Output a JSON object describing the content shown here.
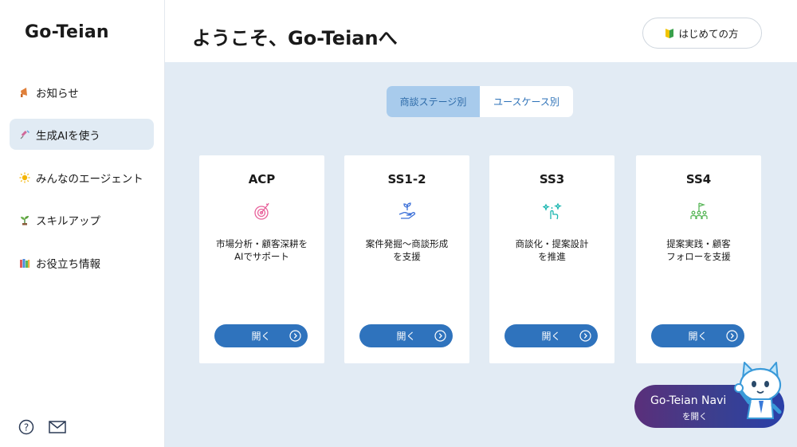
{
  "sidebar": {
    "brand": "Go-Teian",
    "items": [
      {
        "label": "お知らせ",
        "icon": "megaphone-icon",
        "active": false
      },
      {
        "label": "生成AIを使う",
        "icon": "syringe-icon",
        "active": true
      },
      {
        "label": "みんなのエージェント",
        "icon": "sun-icon",
        "active": false
      },
      {
        "label": "スキルアップ",
        "icon": "sprout-icon",
        "active": false
      },
      {
        "label": "お役立ち情報",
        "icon": "books-icon",
        "active": false
      }
    ],
    "footer_icons": [
      "help-circle-icon",
      "mail-icon"
    ]
  },
  "header": {
    "title": "ようこそ、Go-Teianへ",
    "beginner_button": "はじめての方",
    "beginner_icon": "beginner-mark-icon"
  },
  "main": {
    "tabs": [
      {
        "label": "商談ステージ別",
        "active": true
      },
      {
        "label": "ユースケース別",
        "active": false
      }
    ],
    "cards": [
      {
        "title": "ACP",
        "icon": "target-icon",
        "icon_color": "#e8609a",
        "description": "市場分析・顧客深耕を\nAIでサポート",
        "button": "開く"
      },
      {
        "title": "SS1-2",
        "icon": "hand-plant-icon",
        "icon_color": "#3a6fd8",
        "description": "案件発掘〜商談形成\nを支援",
        "button": "開く"
      },
      {
        "title": "SS3",
        "icon": "sparkle-hand-icon",
        "icon_color": "#1bb6b0",
        "description": "商談化・提案設計\nを推進",
        "button": "開く"
      },
      {
        "title": "SS4",
        "icon": "team-flag-icon",
        "icon_color": "#5cb85c",
        "description": "提案実践・顧客\nフォローを支援",
        "button": "開く"
      }
    ]
  },
  "navi": {
    "title": "Go-Teian Navi",
    "subtitle": "を開く",
    "mascot": "cat-mascot-icon"
  },
  "colors": {
    "accent": "#2f73bd",
    "main_bg": "#e2ebf4",
    "active_tab": "#a8cbec",
    "sidebar_active": "#e1ebf4"
  }
}
